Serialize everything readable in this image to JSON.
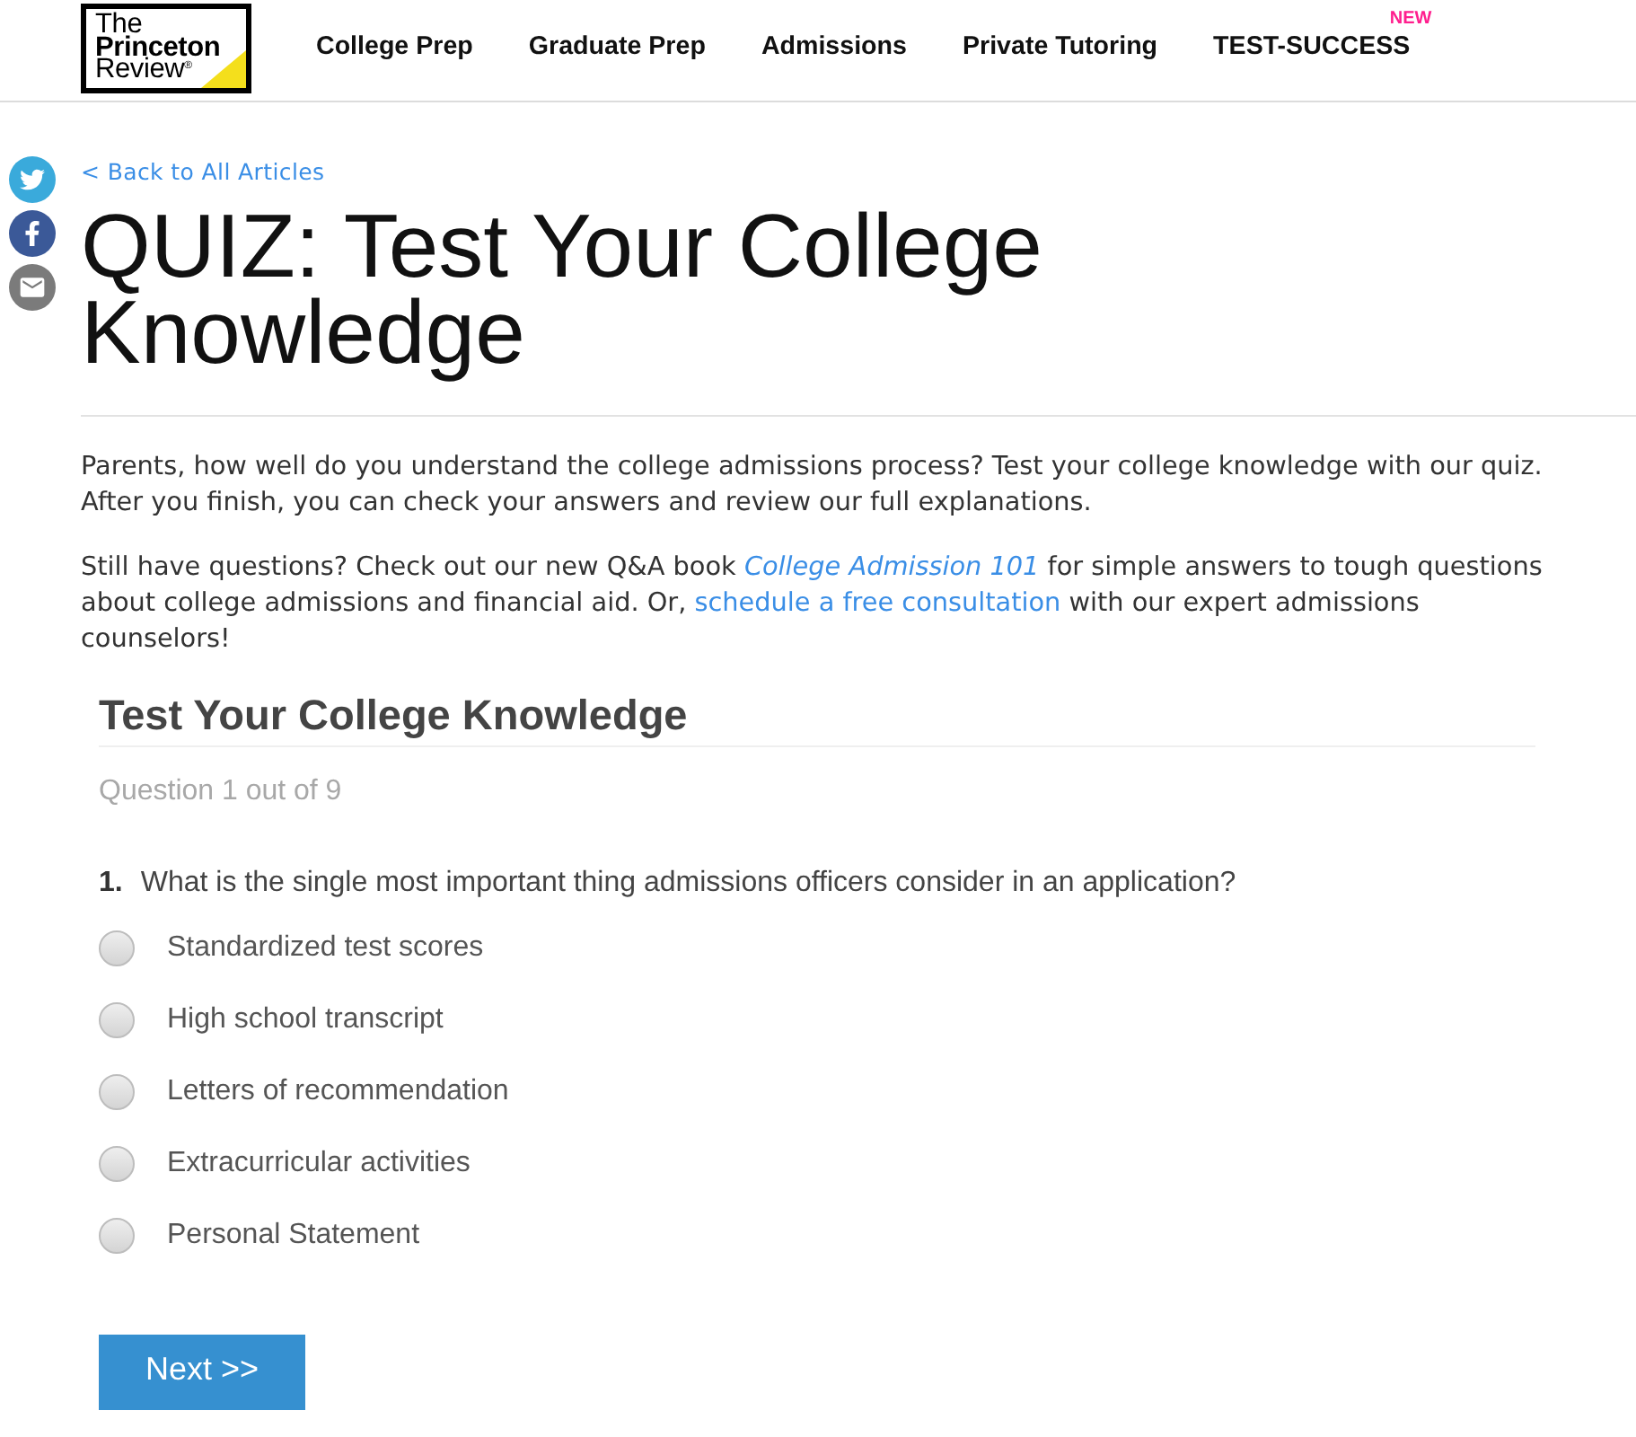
{
  "header": {
    "logo": {
      "text": "The **Princeton** Review$^{®}$"
    },
    "nav": [
      {
        "label": "College Prep"
      },
      {
        "label": "Graduate Prep"
      },
      {
        "label": "Admissions"
      },
      {
        "label": "Private Tutoring"
      },
      {
        "label": "TEST-SUCCESS",
        "badge": "NEW"
      }
    ]
  },
  "share": [
    {
      "kind": "twitter"
    },
    {
      "kind": "facebook"
    },
    {
      "kind": "email"
    }
  ],
  "article": {
    "back_link": "< Back to All Articles",
    "title": "QUIZ: Test Your College Knowledge",
    "paragraphs": [
      [
        {
          "kind": "text",
          "text": "Parents, how well do you understand the college admissions process? Test your college knowledge with our quiz.  After you finish, you can check your answers and review our full explanations."
        }
      ],
      [
        {
          "kind": "text",
          "text": "Still have questions? Check out our new Q&A book "
        },
        {
          "kind": "link",
          "text": "College Admission 101",
          "italic": true
        },
        {
          "kind": "text",
          "text": " for simple answers to tough questions about college admissions and financial aid. Or, "
        },
        {
          "kind": "link",
          "text": "schedule a free consultation",
          "italic": false
        },
        {
          "kind": "text",
          "text": " with our expert admissions counselors!"
        }
      ]
    ]
  },
  "quiz": {
    "title": "Test Your College Knowledge",
    "counter": "Question 1 out of 9",
    "question": {
      "number": "1.",
      "text": "What is the single most important thing admissions officers consider in an application?"
    },
    "options": [
      {
        "label": "Standardized test scores",
        "selected": false
      },
      {
        "label": "High school transcript",
        "selected": false
      },
      {
        "label": "Letters of recommendation",
        "selected": false
      },
      {
        "label": "Extracurricular activities",
        "selected": false
      },
      {
        "label": "Personal Statement",
        "selected": false
      }
    ],
    "next_button": "Next >>"
  }
}
